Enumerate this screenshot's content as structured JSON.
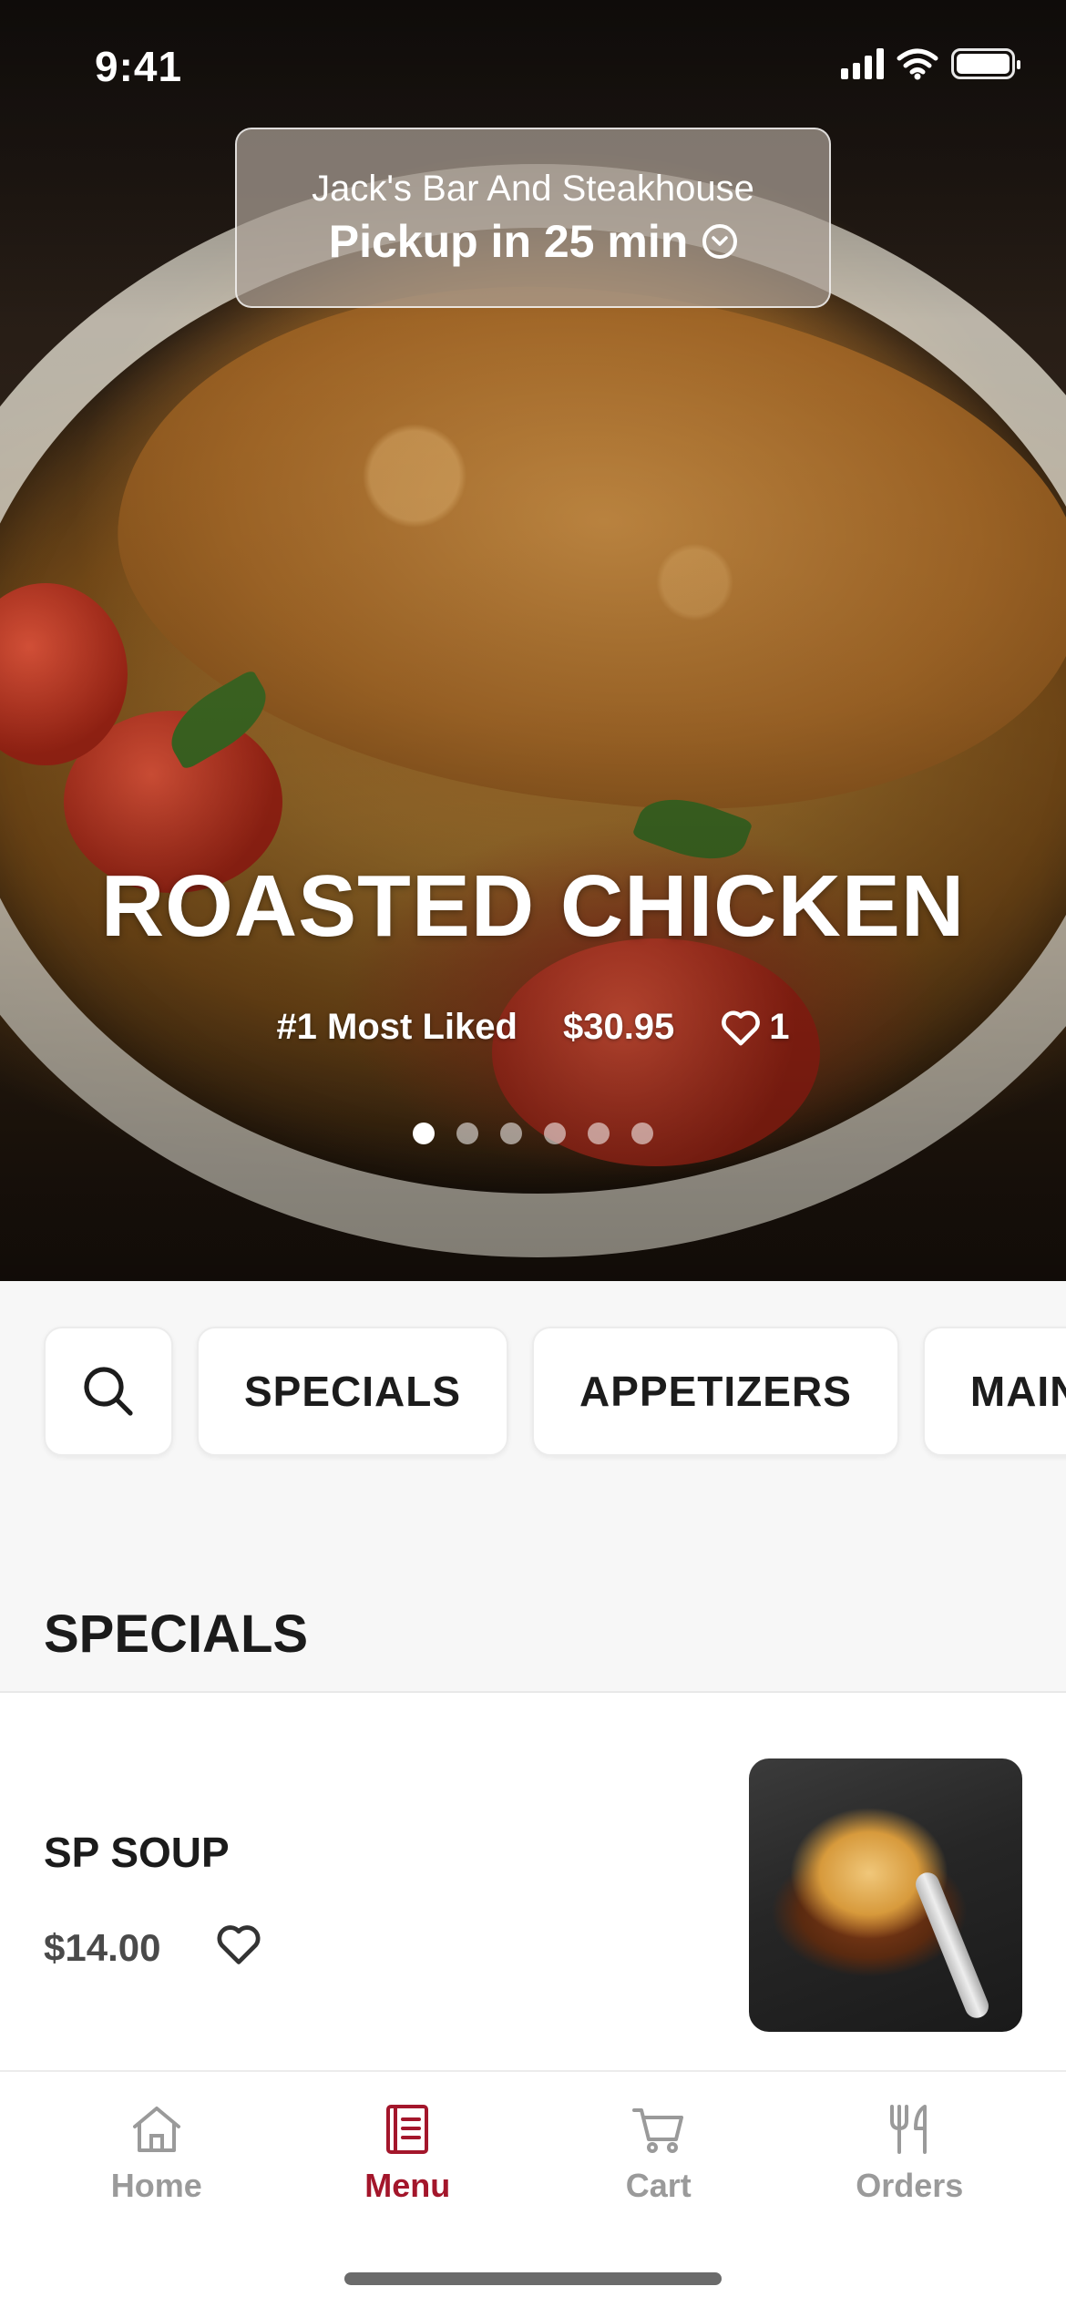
{
  "status_bar": {
    "time": "9:41"
  },
  "pickup": {
    "restaurant": "Jack's Bar And Steakhouse",
    "time_label": "Pickup in 25 min"
  },
  "hero": {
    "title": "ROASTED CHICKEN",
    "badge": "#1 Most Liked",
    "price": "$30.95",
    "likes": "1",
    "carousel": {
      "count": 6,
      "active_index": 0
    }
  },
  "categories": [
    "SPECIALS",
    "APPETIZERS",
    "MAIN"
  ],
  "section": {
    "title": "SPECIALS"
  },
  "items": [
    {
      "name": "SP SOUP",
      "price": "$14.00"
    }
  ],
  "tabs": [
    {
      "label": "Home",
      "icon": "home-icon",
      "active": false
    },
    {
      "label": "Menu",
      "icon": "menu-book-icon",
      "active": true
    },
    {
      "label": "Cart",
      "icon": "cart-icon",
      "active": false
    },
    {
      "label": "Orders",
      "icon": "fork-knife-icon",
      "active": false
    }
  ],
  "colors": {
    "accent": "#a3162b",
    "inactive": "#9a9a9a"
  }
}
